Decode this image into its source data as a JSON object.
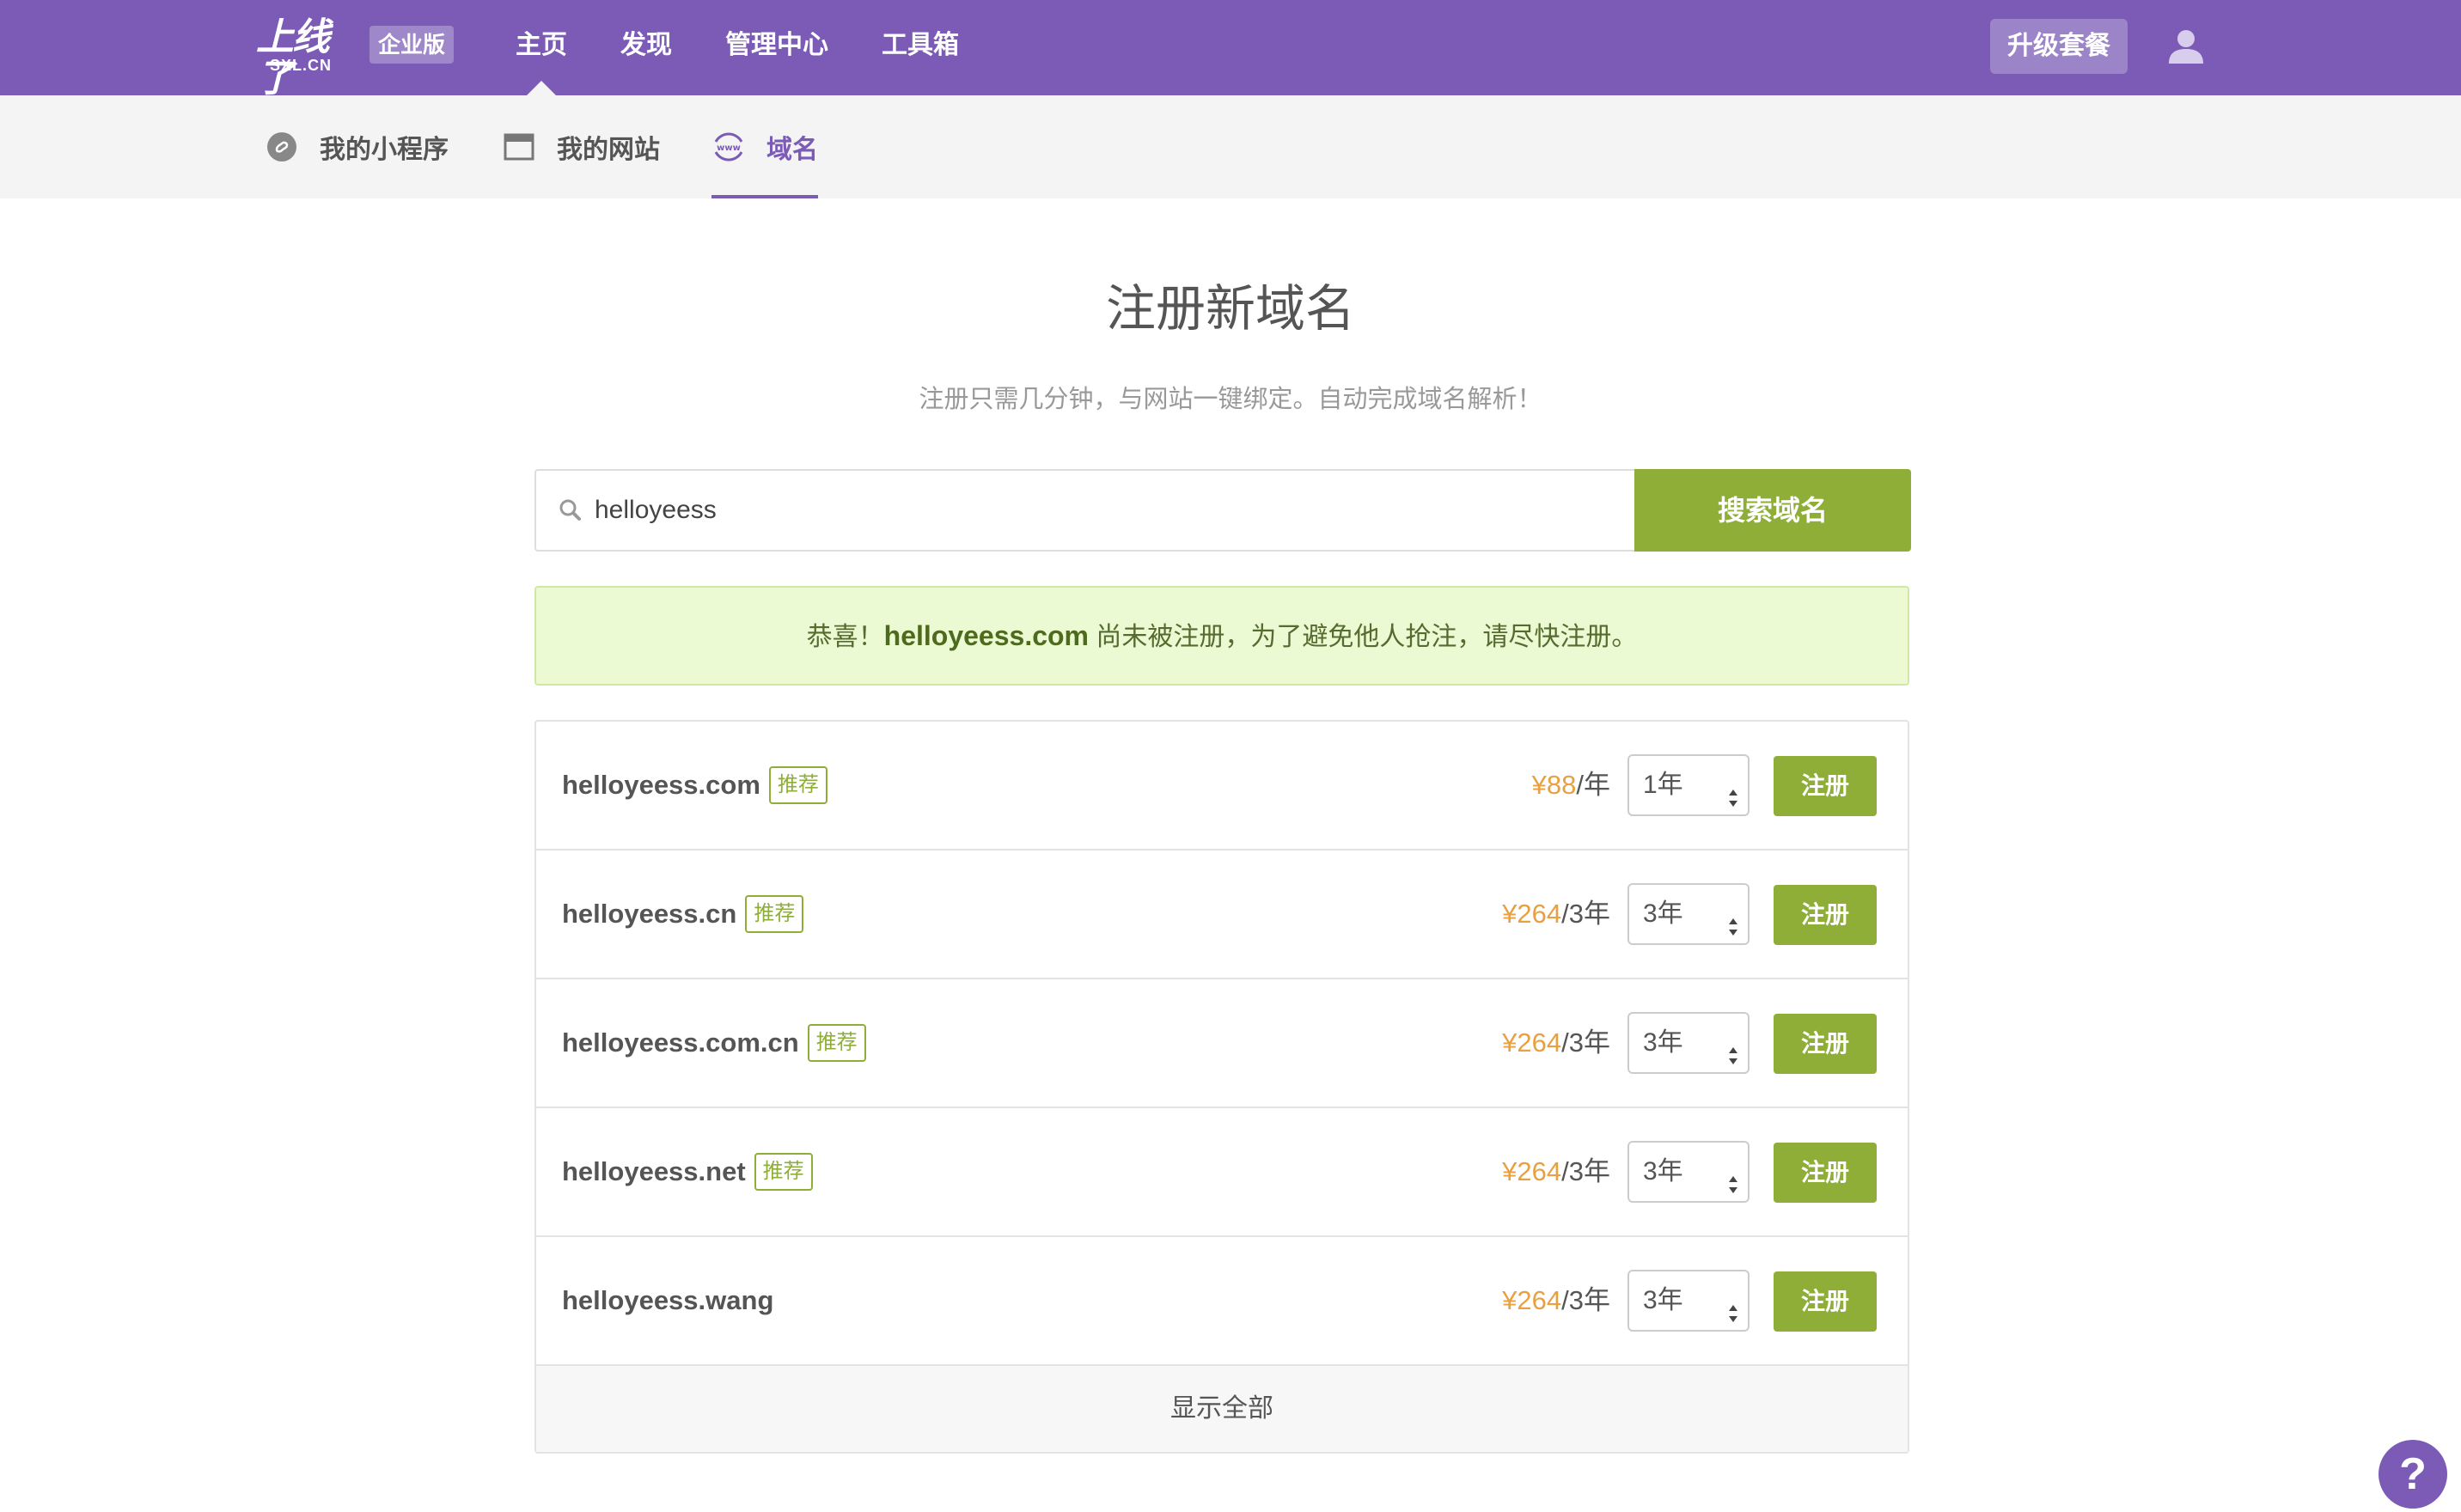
{
  "header": {
    "logo_text": "上线了",
    "logo_sub": "SXL.CN",
    "edition": "企业版",
    "nav": [
      {
        "label": "主页",
        "active": true
      },
      {
        "label": "发现",
        "active": false
      },
      {
        "label": "管理中心",
        "active": false
      },
      {
        "label": "工具箱",
        "active": false
      }
    ],
    "upgrade_label": "升级套餐",
    "user_icon": "user-icon"
  },
  "subnav": [
    {
      "label": "我的小程序",
      "icon": "mini-program-icon",
      "active": false
    },
    {
      "label": "我的网站",
      "icon": "website-icon",
      "active": false
    },
    {
      "label": "域名",
      "icon": "www-icon",
      "active": true
    }
  ],
  "main": {
    "title": "注册新域名",
    "subtitle": "注册只需几分钟，与网站一键绑定。自动完成域名解析！",
    "search": {
      "value": "helloyeess",
      "button_label": "搜索域名",
      "icon": "search-icon"
    },
    "notice": {
      "prefix": "恭喜！",
      "domain": "helloyeess.com",
      "suffix": " 尚未被注册，为了避免他人抢注，请尽快注册。"
    },
    "results": [
      {
        "domain": "helloyeess.com",
        "tag": "推荐",
        "price": "¥88",
        "unit": "/年",
        "period": "1年",
        "button": "注册"
      },
      {
        "domain": "helloyeess.cn",
        "tag": "推荐",
        "price": "¥264",
        "unit": "/3年",
        "period": "3年",
        "button": "注册"
      },
      {
        "domain": "helloyeess.com.cn",
        "tag": "推荐",
        "price": "¥264",
        "unit": "/3年",
        "period": "3年",
        "button": "注册"
      },
      {
        "domain": "helloyeess.net",
        "tag": "推荐",
        "price": "¥264",
        "unit": "/3年",
        "period": "3年",
        "button": "注册"
      },
      {
        "domain": "helloyeess.wang",
        "tag": "",
        "price": "¥264",
        "unit": "/3年",
        "period": "3年",
        "button": "注册"
      }
    ],
    "show_all": "显示全部"
  },
  "help_label": "?",
  "colors": {
    "brand": "#7b5bb6",
    "accent_green": "#8eae38",
    "price": "#e8a040",
    "notice_bg": "#ebfad3"
  }
}
